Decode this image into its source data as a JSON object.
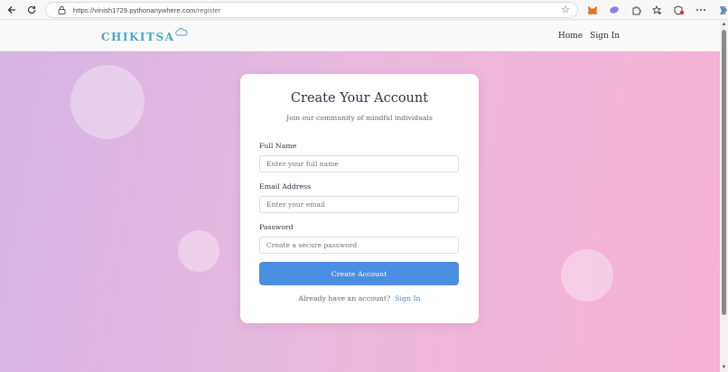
{
  "browser": {
    "url_host": "https://vinish1729.pythonanywhere.com",
    "url_path": "/register",
    "icons": [
      "back-icon",
      "reload-icon",
      "lock-icon",
      "star-icon",
      "metamask-icon",
      "extension-icon",
      "puzzle-icon",
      "favorites-icon",
      "shield-icon",
      "more-icon",
      "copilot-icon"
    ]
  },
  "site": {
    "logo": "CHIKITSA",
    "nav": {
      "home": "Home",
      "sign_in": "Sign In"
    }
  },
  "form": {
    "title": "Create Your Account",
    "subtitle": "Join our community of mindful individuals",
    "name_label": "Full Name",
    "name_placeholder": "Enter your full name",
    "email_label": "Email Address",
    "email_placeholder": "Enter your email",
    "password_label": "Password",
    "password_placeholder": "Create a secure password",
    "submit": "Create Account",
    "signin_prompt": "Already have an account?",
    "signin_link": "Sign In"
  },
  "colors": {
    "accent": "#4a8ee0",
    "logo": "#4aa7c9",
    "gradient_start": "#d4b5e4",
    "gradient_end": "#f6b1d4"
  }
}
